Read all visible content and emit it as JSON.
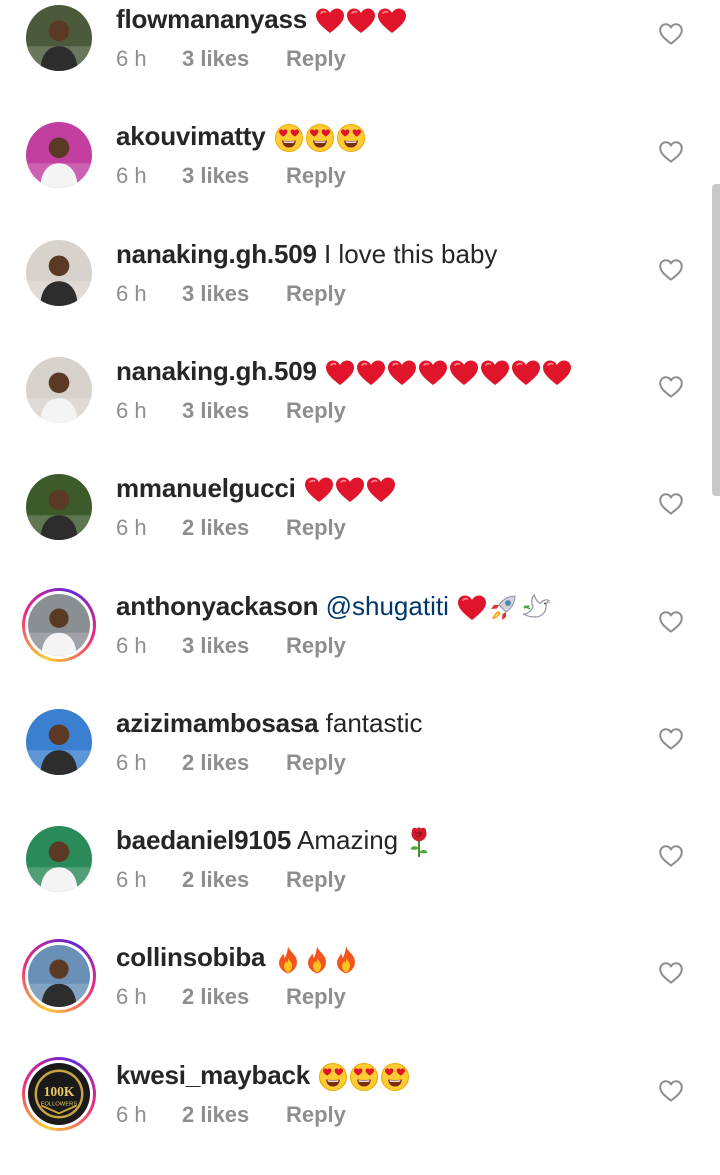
{
  "comments": [
    {
      "username": "flowmananyass",
      "text": "",
      "mention": "",
      "emojis": [
        "red-heart",
        "red-heart",
        "red-heart"
      ],
      "time": "6 h",
      "likes": "3 likes",
      "reply": "Reply",
      "story_ring": false,
      "avatar_color": "#4a5a3a"
    },
    {
      "username": "akouvimatty",
      "text": "",
      "mention": "",
      "emojis": [
        "heart-eyes",
        "heart-eyes",
        "heart-eyes"
      ],
      "time": "6 h",
      "likes": "3 likes",
      "reply": "Reply",
      "story_ring": false,
      "avatar_color": "#c23fa0"
    },
    {
      "username": "nanaking.gh.509",
      "text": "I love this baby",
      "mention": "",
      "emojis": [],
      "time": "6 h",
      "likes": "3 likes",
      "reply": "Reply",
      "story_ring": false,
      "avatar_color": "#d8d2cc"
    },
    {
      "username": "nanaking.gh.509",
      "text": "",
      "mention": "",
      "emojis": [
        "red-heart",
        "red-heart",
        "red-heart",
        "red-heart",
        "red-heart",
        "red-heart",
        "red-heart",
        "red-heart"
      ],
      "time": "6 h",
      "likes": "3 likes",
      "reply": "Reply",
      "story_ring": false,
      "avatar_color": "#d8d2cc"
    },
    {
      "username": "mmanuelgucci",
      "text": "",
      "mention": "",
      "emojis": [
        "red-heart",
        "red-heart",
        "red-heart"
      ],
      "time": "6 h",
      "likes": "2 likes",
      "reply": "Reply",
      "story_ring": false,
      "avatar_color": "#3c5a2a"
    },
    {
      "username": "anthonyackason",
      "text": "",
      "mention": "@shugatiti",
      "emojis": [
        "red-heart",
        "rocket",
        "dove"
      ],
      "time": "6 h",
      "likes": "3 likes",
      "reply": "Reply",
      "story_ring": true,
      "avatar_color": "#8a8f94"
    },
    {
      "username": "azizimambosasa",
      "text": "fantastic",
      "mention": "",
      "emojis": [],
      "time": "6 h",
      "likes": "2 likes",
      "reply": "Reply",
      "story_ring": false,
      "avatar_color": "#3a7fd0"
    },
    {
      "username": "baedaniel9105",
      "text": "Amazing",
      "mention": "",
      "emojis": [
        "rose"
      ],
      "time": "6 h",
      "likes": "2 likes",
      "reply": "Reply",
      "story_ring": false,
      "avatar_color": "#2a8a5a"
    },
    {
      "username": "collinsobiba",
      "text": "",
      "mention": "",
      "emojis": [
        "fire",
        "fire",
        "fire"
      ],
      "time": "6 h",
      "likes": "2 likes",
      "reply": "Reply",
      "story_ring": true,
      "avatar_color": "#6a90b8"
    },
    {
      "username": "kwesi_mayback",
      "text": "",
      "mention": "",
      "emojis": [
        "heart-eyes",
        "heart-eyes",
        "heart-eyes"
      ],
      "time": "6 h",
      "likes": "2 likes",
      "reply": "Reply",
      "story_ring": true,
      "avatar_color": "#1a1a1a",
      "avatar_text": [
        "100K",
        "FOLLOWERS"
      ]
    }
  ],
  "colors": {
    "heart_outline": "#8e8e8e",
    "meta_text": "#8e8e8e",
    "mention": "#00376b",
    "primary_text": "#262626"
  }
}
